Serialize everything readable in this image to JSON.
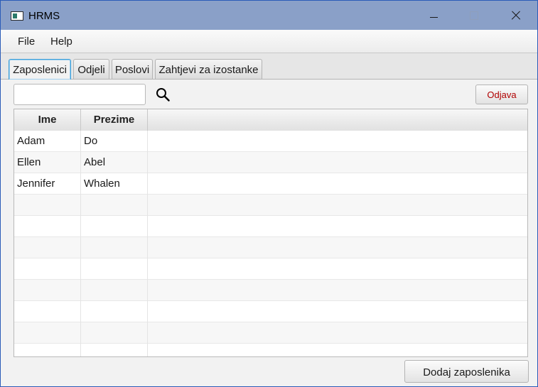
{
  "window": {
    "title": "HRMS",
    "app_icon": "window-app-icon",
    "controls": [
      "minimize-icon",
      "maximize-icon",
      "close-icon"
    ]
  },
  "menu": {
    "items": [
      {
        "label": "File"
      },
      {
        "label": "Help"
      }
    ]
  },
  "tabs": [
    {
      "label": "Zaposlenici",
      "active": true
    },
    {
      "label": "Odjeli",
      "active": false
    },
    {
      "label": "Poslovi",
      "active": false
    },
    {
      "label": "Zahtjevi za izostanke",
      "active": false
    }
  ],
  "search": {
    "value": "",
    "placeholder": "",
    "icon": "search-icon"
  },
  "logout_label": "Odjava",
  "table": {
    "columns": [
      "Ime",
      "Prezime"
    ],
    "rows": [
      {
        "ime": "Adam",
        "prezime": "Do"
      },
      {
        "ime": "Ellen",
        "prezime": "Abel"
      },
      {
        "ime": "Jennifer",
        "prezime": "Whalen"
      }
    ]
  },
  "add_button_label": "Dodaj zaposlenika",
  "colors": {
    "titlebar": "#8aa0c8",
    "active_tab_border": "#3a9ed8",
    "logout_text": "#b00000"
  }
}
